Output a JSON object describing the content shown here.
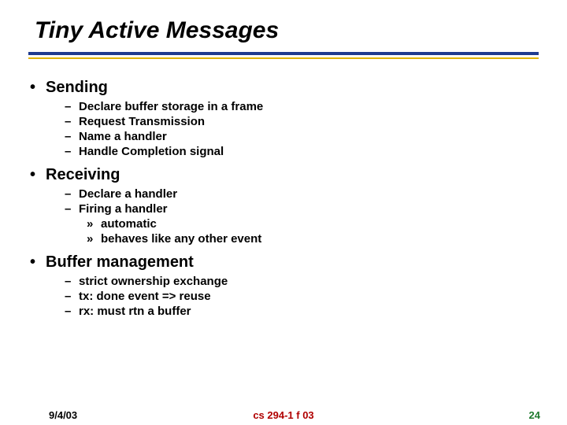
{
  "title": "Tiny Active Messages",
  "bullets": {
    "sending": {
      "label": "Sending",
      "items": [
        "Declare buffer storage in a frame",
        "Request Transmission",
        "Name a handler",
        "Handle Completion signal"
      ]
    },
    "receiving": {
      "label": "Receiving",
      "items": [
        "Declare a handler",
        "Firing a handler"
      ],
      "sub": [
        "automatic",
        "behaves like any other event"
      ]
    },
    "buffer": {
      "label": "Buffer management",
      "items": [
        "strict ownership exchange",
        "tx: done event => reuse",
        "rx: must rtn a buffer"
      ]
    }
  },
  "glyphs": {
    "dot": "•",
    "dash": "–",
    "raquo": "»"
  },
  "footer": {
    "date": "9/4/03",
    "course": "cs 294-1 f 03",
    "page": "24"
  }
}
